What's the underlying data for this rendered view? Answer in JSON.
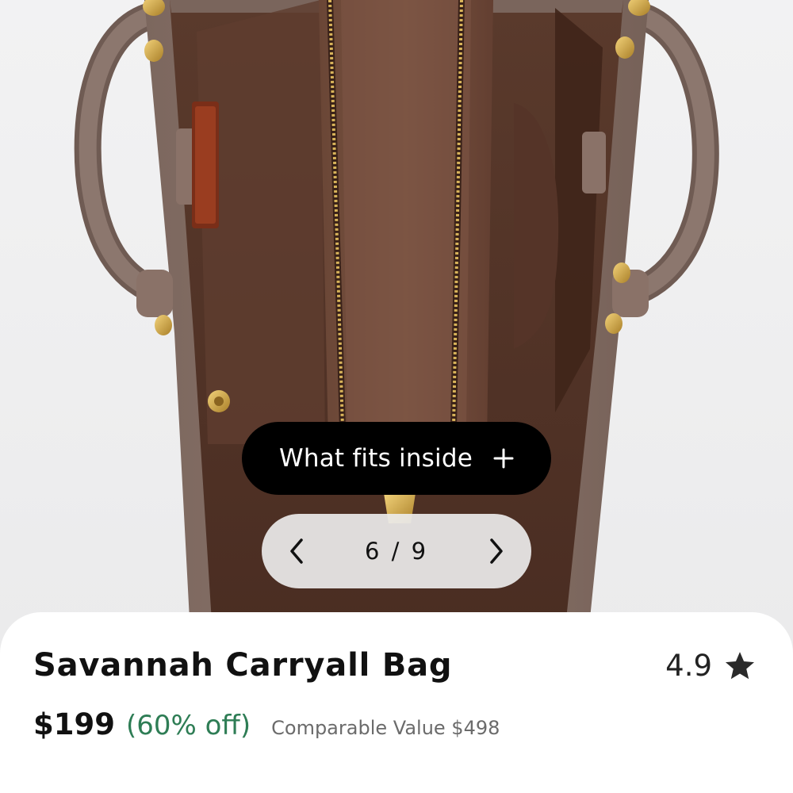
{
  "gallery": {
    "fits_button_label": "What fits inside",
    "fits_icon": "plus-icon",
    "pager": {
      "text": "6 / 9",
      "prev_icon": "chevron-left-icon",
      "next_icon": "chevron-right-icon"
    }
  },
  "product": {
    "name": "Savannah Carryall Bag",
    "rating": "4.9",
    "rating_icon": "star-icon",
    "price": "$199",
    "discount": "(60% off)",
    "comparable_value": "Comparable Value $498"
  },
  "colors": {
    "discount": "#2e7d55",
    "pill_background": "#000000",
    "sheet_background": "#ffffff"
  }
}
